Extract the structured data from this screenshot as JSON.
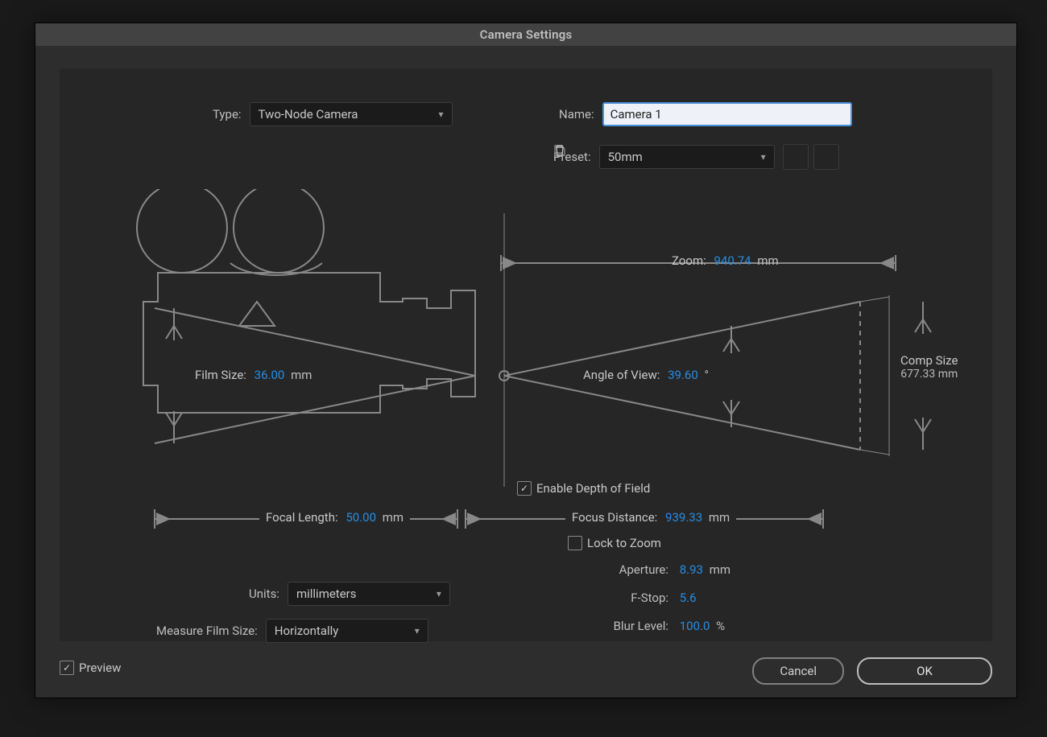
{
  "dialog": {
    "title": "Camera Settings"
  },
  "type": {
    "label": "Type:",
    "value": "Two-Node Camera"
  },
  "name": {
    "label": "Name:",
    "value": "Camera 1"
  },
  "preset": {
    "label": "Preset:",
    "value": "50mm"
  },
  "diagram": {
    "zoom": {
      "label": "Zoom:",
      "value": "940.74",
      "unit": "mm"
    },
    "filmSize": {
      "label": "Film Size:",
      "value": "36.00",
      "unit": "mm"
    },
    "angleOfView": {
      "label": "Angle of View:",
      "value": "39.60",
      "unit": "°"
    },
    "compSize": {
      "label": "Comp Size",
      "value": "677.33 mm"
    },
    "focalLength": {
      "label": "Focal Length:",
      "value": "50.00",
      "unit": "mm"
    },
    "focusDistance": {
      "label": "Focus Distance:",
      "value": "939.33",
      "unit": "mm"
    }
  },
  "depth": {
    "enable": {
      "label": "Enable Depth of Field",
      "checked": true
    },
    "lock": {
      "label": "Lock to Zoom",
      "checked": false
    },
    "aperture": {
      "label": "Aperture:",
      "value": "8.93",
      "unit": "mm"
    },
    "fstop": {
      "label": "F-Stop:",
      "value": "5.6"
    },
    "blur": {
      "label": "Blur Level:",
      "value": "100.0",
      "unit": "%"
    }
  },
  "units": {
    "label": "Units:",
    "value": "millimeters"
  },
  "measure": {
    "label": "Measure Film Size:",
    "value": "Horizontally"
  },
  "footer": {
    "preview": "Preview",
    "cancel": "Cancel",
    "ok": "OK"
  }
}
